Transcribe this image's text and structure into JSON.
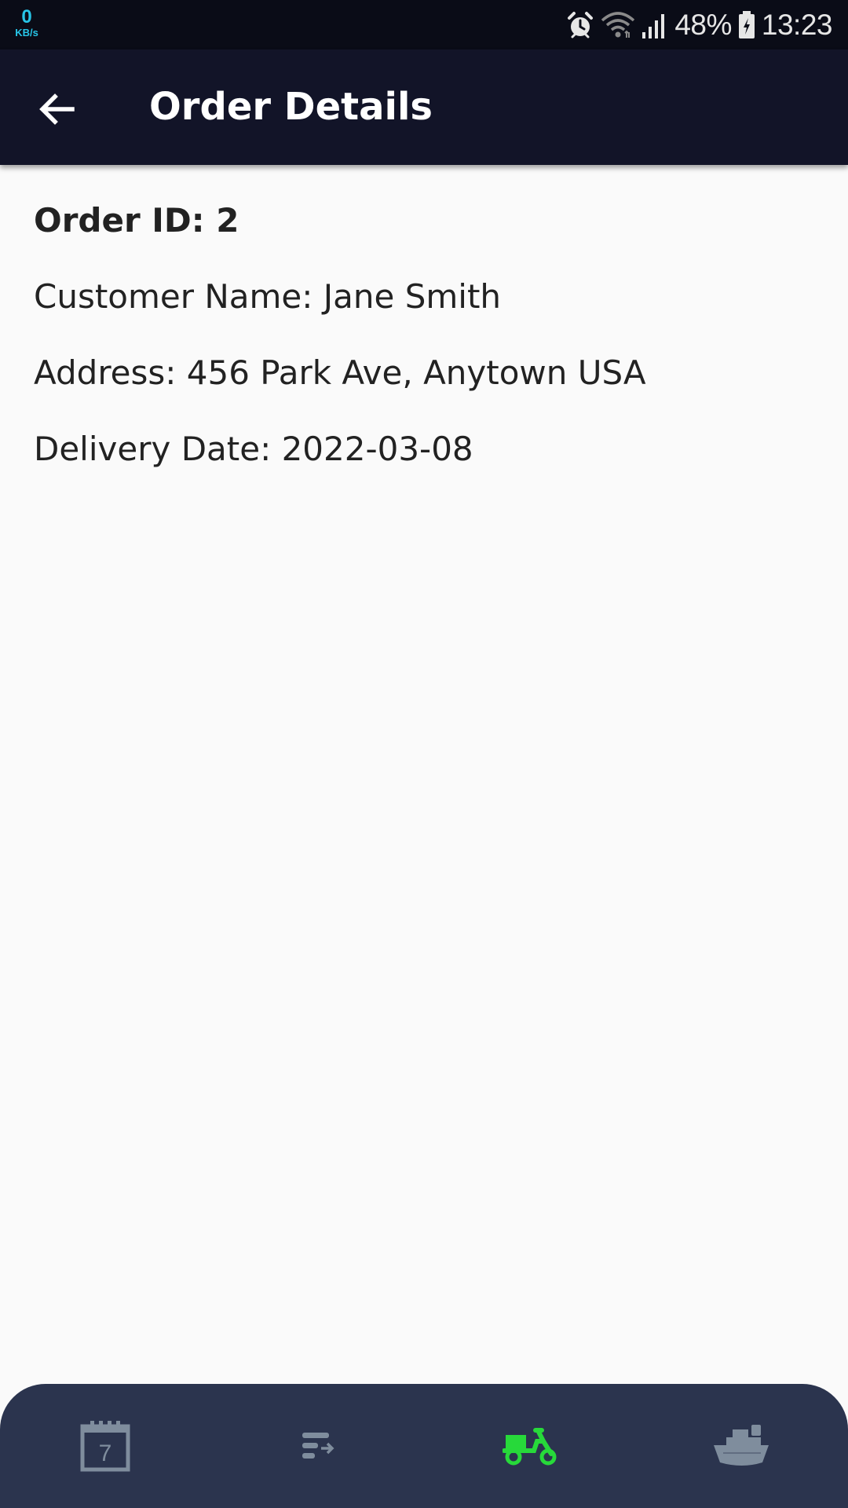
{
  "status_bar": {
    "net_speed_value": "0",
    "net_speed_unit": "KB/s",
    "battery_percent": "48%",
    "time": "13:23",
    "icons": [
      "alarm-icon",
      "wifi-icon",
      "signal-icon",
      "battery-charging-icon"
    ]
  },
  "app_bar": {
    "title": "Order Details",
    "back_icon": "arrow-left-icon"
  },
  "order": {
    "order_id": "Order ID: 2",
    "customer_name": "Customer Name: Jane Smith",
    "address": "Address: 456 Park Ave, Anytown USA",
    "delivery_date": "Delivery Date: 2022-03-08"
  },
  "bottom_nav": {
    "items": [
      {
        "icon": "calendar-icon",
        "calendar_day": "7",
        "active": false
      },
      {
        "icon": "list-arrow-icon",
        "active": false
      },
      {
        "icon": "scooter-delivery-icon",
        "active": true
      },
      {
        "icon": "ship-icon",
        "active": false
      }
    ],
    "colors": {
      "background": "#2b344e",
      "inactive": "#7f8d9d",
      "active": "#27d93a"
    }
  },
  "colors": {
    "status_bar_bg": "#0a0c17",
    "app_bar_bg": "#121428",
    "page_bg": "#fafafa",
    "text": "#222222",
    "net_speed": "#27c6e8"
  }
}
